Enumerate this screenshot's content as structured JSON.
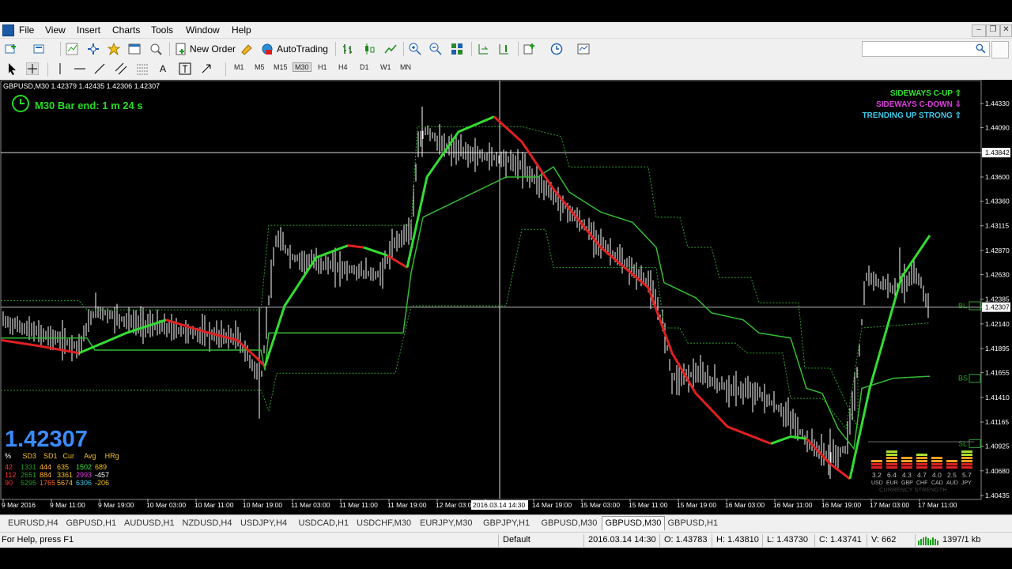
{
  "menu": [
    "File",
    "View",
    "Insert",
    "Charts",
    "Tools",
    "Window",
    "Help"
  ],
  "toolbar": {
    "new_order": "New Order",
    "autotrading": "AutoTrading"
  },
  "timeframes": [
    "M1",
    "M5",
    "M15",
    "M30",
    "H1",
    "H4",
    "D1",
    "W1",
    "MN"
  ],
  "active_timeframe": "M30",
  "chart": {
    "title": "GBPUSD,M30  1.42379 1.42435 1.42306 1.42307",
    "timer": "M30 Bar end: 1 m 24 s",
    "big_price": "1.42307",
    "signals": [
      {
        "text": "SIDEWAYS C-UP ⇧",
        "color": "#2ee62e"
      },
      {
        "text": "SIDEWAYS C-DOWN ⇩",
        "color": "#e03ce0"
      },
      {
        "text": "TRENDING UP STRONG ⇧",
        "color": "#3cc8e8"
      }
    ],
    "stats": {
      "header": [
        "%",
        "SD3",
        "SD1",
        "Cur",
        "Avg",
        "HRg"
      ],
      "rows": [
        [
          "42",
          "1331",
          "444",
          "635",
          "1502",
          "689"
        ],
        [
          "112",
          "2651",
          "884",
          "3361",
          "2993",
          "-457"
        ],
        [
          "90",
          "5295",
          "1765",
          "5674",
          "6306",
          "-206"
        ]
      ]
    },
    "price_ticks": [
      "1.44330",
      "1.44090",
      "1.43842",
      "1.43600",
      "1.43360",
      "1.43115",
      "1.42870",
      "1.42630",
      "1.42385",
      "1.42307",
      "1.42140",
      "1.41895",
      "1.41655",
      "1.41410",
      "1.41165",
      "1.40925",
      "1.40680",
      "1.40435"
    ],
    "time_ticks": [
      "9 Mar 2016",
      "9 Mar 11:00",
      "9 Mar 19:00",
      "10 Mar 03:00",
      "10 Mar 11:00",
      "10 Mar 19:00",
      "11 Mar 03:00",
      "11 Mar 11:00",
      "11 Mar 19:00",
      "12 Mar 03:00",
      "2016.03.14 14:30",
      "14 Mar 19:00",
      "15 Mar 03:00",
      "15 Mar 11:00",
      "15 Mar 19:00",
      "16 Mar 03:00",
      "16 Mar 11:00",
      "16 Mar 19:00",
      "17 Mar 03:00",
      "17 Mar 11:00"
    ],
    "strength": {
      "values": [
        "3.2",
        "6.4",
        "4.3",
        "4.7",
        "4.0",
        "2.5",
        "5.7"
      ],
      "currencies": [
        "USD",
        "EUR",
        "GBP",
        "CHF",
        "CAD",
        "AUD",
        "JPY"
      ],
      "label": "CURRENCY STRENGTH"
    },
    "right_labels": [
      "BL",
      "BS",
      "SL"
    ]
  },
  "tabs": [
    "EURUSD,H4",
    "GBPUSD,H1",
    "AUDUSD,H1",
    "NZDUSD,H4",
    "USDJPY,H4",
    "USDCAD,H1",
    "USDCHF,M30",
    "EURJPY,M30",
    "GBPJPY,H1",
    "GBPUSD,M30",
    "GBPUSD,M30",
    "GBPUSD,H1"
  ],
  "active_tab": 10,
  "status": {
    "help": "For Help, press F1",
    "profile": "Default",
    "datetime": "2016.03.14 14:30",
    "open": "O: 1.43783",
    "high": "H: 1.43810",
    "low": "L: 1.43730",
    "close": "C: 1.43741",
    "volume": "V: 662",
    "traffic": "1397/1 kb"
  },
  "colors": {
    "bull": "#33dd33",
    "bear": "#e02020",
    "grid": "#444444",
    "bars": "#ffffff"
  }
}
